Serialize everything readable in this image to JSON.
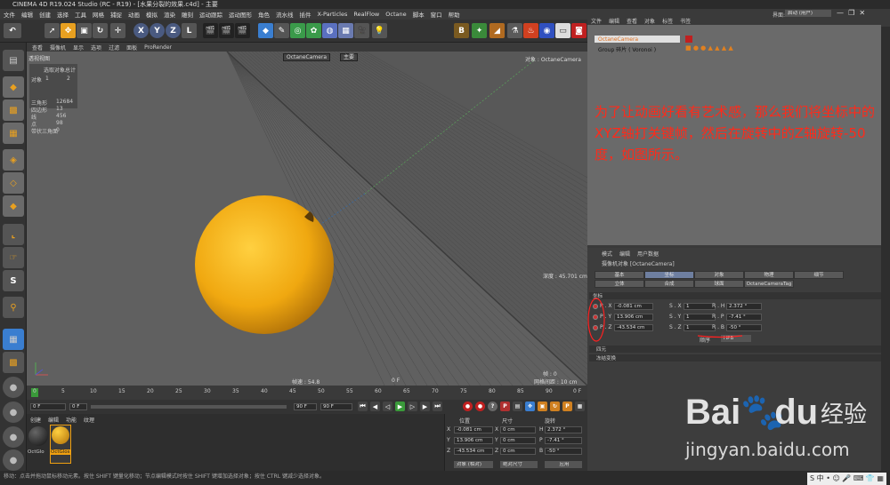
{
  "window": {
    "title": "CINEMA 4D R19.024 Studio (RC - R19) - [水果分裂的效果.c4d] - 主要",
    "layout_label": "界面:",
    "layout_value": "启动 (用户)"
  },
  "menu": [
    "文件",
    "编辑",
    "创建",
    "选择",
    "工具",
    "网格",
    "捕捉",
    "动画",
    "模拟",
    "渲染",
    "雕刻",
    "运动跟踪",
    "运动图形",
    "角色",
    "流水线",
    "插件",
    "X-Particles",
    "RealFlow",
    "Octane",
    "脚本",
    "窗口",
    "帮助"
  ],
  "viewport": {
    "menu": [
      "查看",
      "摄像机",
      "显示",
      "选项",
      "过滤",
      "面板",
      "ProRender"
    ],
    "header_label": "透视视图",
    "camera_tag": "OctaneCamera",
    "camera_tag2": "主要",
    "top_right": "对象 : OctaneCamera",
    "stats": {
      "h1": "选取对象",
      "h2": "总计",
      "r1a": "对象",
      "r1b": "1",
      "r1c": "2",
      "rows": [
        [
          "三角形",
          "12684"
        ],
        [
          "四边形",
          "13"
        ],
        [
          "线",
          "456"
        ],
        [
          "点",
          "98"
        ],
        [
          "带状三角面",
          "0"
        ]
      ]
    },
    "depth": "深度 : 45.701 cm",
    "speed": "帧速 : 54.8",
    "frame": "0 F",
    "frame_right": "帧 : 0",
    "grid": "网格间距 : 10 cm"
  },
  "timeline": {
    "ticks": [
      "0",
      "5",
      "10",
      "15",
      "20",
      "25",
      "30",
      "35",
      "40",
      "45",
      "50",
      "55",
      "60",
      "65",
      "70",
      "75",
      "80",
      "85",
      "90"
    ],
    "end": "0 F"
  },
  "playbar": {
    "start": "0 F",
    "cur": "0 F",
    "end1": "90 F",
    "end2": "90 F"
  },
  "materials": {
    "menu": [
      "创建",
      "编辑",
      "功能",
      "纹理"
    ],
    "items": [
      "OctGlo",
      "OctGlos"
    ]
  },
  "coords": {
    "headers": [
      "位置",
      "尺寸",
      "旋转"
    ],
    "rows": [
      {
        "a": "X",
        "v1": "-0.081 cm",
        "b": "X",
        "v2": "0 cm",
        "c": "H",
        "v3": "2.372 °"
      },
      {
        "a": "Y",
        "v1": "13.906 cm",
        "b": "Y",
        "v2": "0 cm",
        "c": "P",
        "v3": "-7.41 °"
      },
      {
        "a": "Z",
        "v1": "-43.534 cm",
        "b": "Z",
        "v2": "0 cm",
        "c": "B",
        "v3": "-50 °"
      }
    ],
    "mode": "对象 (相对)",
    "size_mode": "绝对尺寸",
    "apply": "应用"
  },
  "objmgr": {
    "menu": [
      "文件",
      "编辑",
      "查看",
      "对象",
      "标签",
      "书签"
    ],
    "items": [
      {
        "name": "OctaneCamera"
      },
      {
        "name": "Group 碎片 ( Voronoi )"
      }
    ]
  },
  "attr": {
    "menu": [
      "模式",
      "编辑",
      "用户数据"
    ],
    "title": "摄像机对象 [OctaneCamera]",
    "tabs": [
      "基本",
      "坐标",
      "对象",
      "物理",
      "细节",
      "立体",
      "合成",
      "球面",
      "OctaneCameraTag"
    ],
    "section": "坐标",
    "rows": [
      {
        "p": "P . X",
        "pv": "-0.081 cm",
        "s": "S . X",
        "sv": "1",
        "r": "R . H",
        "rv": "2.372 °"
      },
      {
        "p": "P . Y",
        "pv": "13.906 cm",
        "s": "S . Y",
        "sv": "1",
        "r": "R . P",
        "rv": "-7.41 °"
      },
      {
        "p": "P . Z",
        "pv": "-43.534 cm",
        "s": "S . Z",
        "sv": "1",
        "r": "R . B",
        "rv": "-50 °"
      }
    ],
    "order_label": "顺序",
    "order_value": "HPB",
    "sub1": "四元",
    "sub2": "冻结变换"
  },
  "note": "为了让动画好看有艺术感，那么我们将坐标中的XYZ轴打关键帧，然后在旋转中的Z轴旋转-50度，如图所示。",
  "statusbar": "移动：点击并拖动鼠标移动元素。按住 SHIFT 键量化移动；节点编辑模式时按住 SHIFT 键增加选择对象；按住 CTRL 键减少选择对象。",
  "watermark": {
    "brand": "Bai",
    "brand2": "du",
    "cn": "经验",
    "url": "jingyan.baidu.com"
  },
  "colors": {
    "accent": "#f0a010",
    "note": "#ff2a1a",
    "ball": "#f4b020"
  }
}
